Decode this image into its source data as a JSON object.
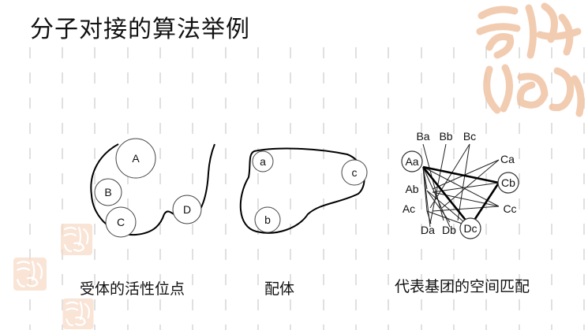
{
  "title": "分子对接的算法举例",
  "captions": {
    "receptor": "受体的活性位点",
    "ligand": "配体",
    "matching": "代表基团的空间匹配"
  },
  "receptor_sites": [
    "A",
    "B",
    "C",
    "D"
  ],
  "ligand_groups": [
    "a",
    "b",
    "c"
  ],
  "graph_nodes": [
    "Aa",
    "Ab",
    "Ac",
    "Ba",
    "Bb",
    "Bc",
    "Ca",
    "Cb",
    "Cc",
    "Da",
    "Db",
    "Dc"
  ],
  "seal_text": "吉祥如意",
  "colors": {
    "grid_line": "#e0e0e0",
    "seal": "#f0c4a4",
    "ink": "#111111"
  }
}
